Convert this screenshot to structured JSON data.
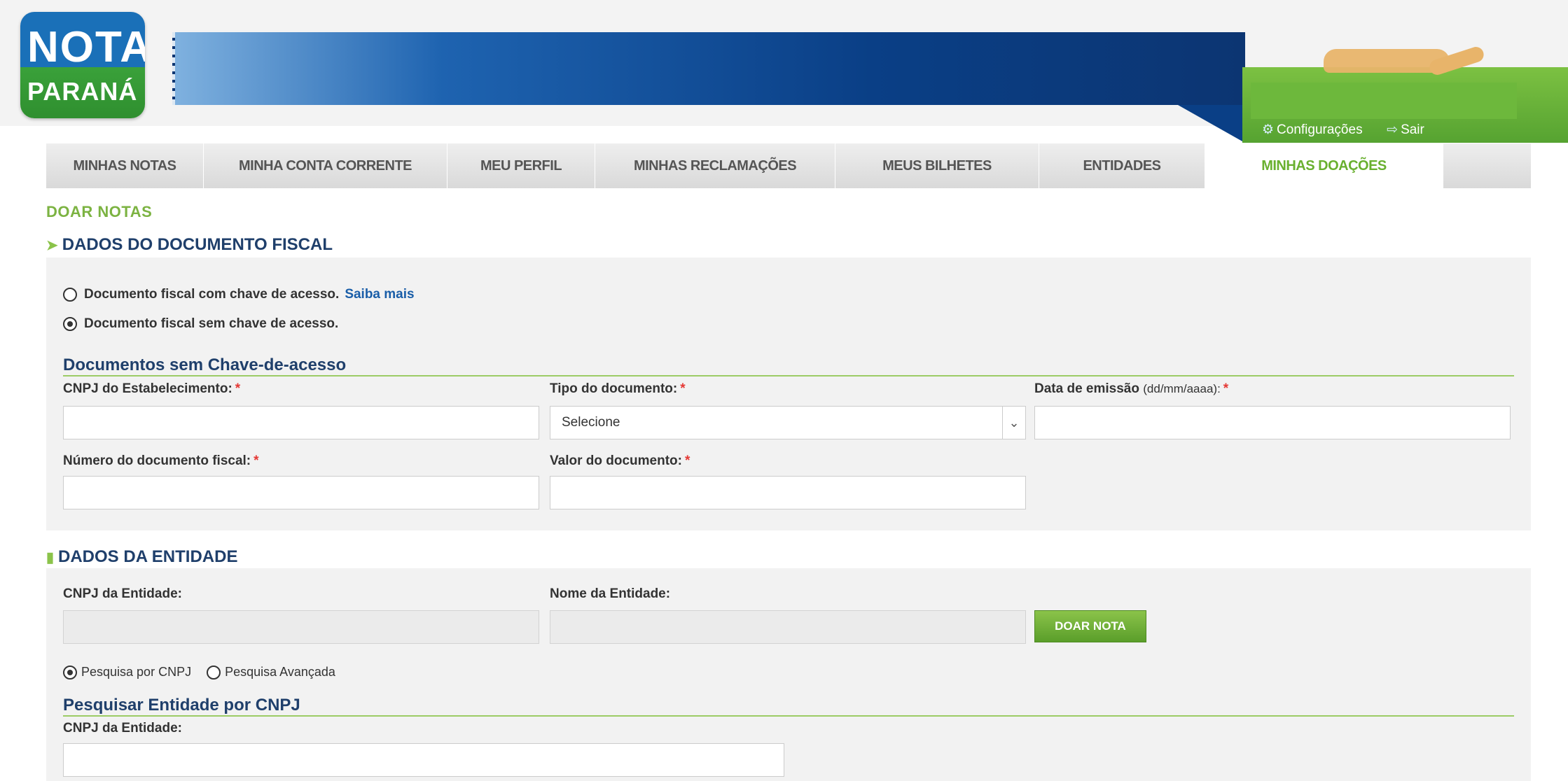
{
  "header": {
    "logo_top": "NOTA",
    "logo_bottom": "PARANÁ",
    "settings_label": "Configurações",
    "logout_label": "Sair",
    "settings_icon": "gear-icon",
    "logout_icon": "exit-icon"
  },
  "tabs": [
    {
      "label": "MINHAS NOTAS",
      "active": false
    },
    {
      "label": "MINHA CONTA CORRENTE",
      "active": false
    },
    {
      "label": "MEU PERFIL",
      "active": false
    },
    {
      "label": "MINHAS RECLAMAÇÕES",
      "active": false
    },
    {
      "label": "MEUS BILHETES",
      "active": false
    },
    {
      "label": "ENTIDADES",
      "active": false
    },
    {
      "label": "MINHAS DOAÇÕES",
      "active": true
    }
  ],
  "page": {
    "title": "DOAR NOTAS"
  },
  "fiscal": {
    "heading": "DADOS DO DOCUMENTO FISCAL",
    "heading_icon": "tag-icon",
    "option_with_key": "Documento fiscal com chave de acesso.",
    "saiba_mais": "Saiba mais",
    "option_without_key": "Documento fiscal sem chave de acesso.",
    "selected_option": "without_key",
    "subheading": "Documentos sem Chave-de-acesso",
    "cnpj_label": "CNPJ do Estabelecimento:",
    "tipo_label": "Tipo do documento:",
    "tipo_selected": "Selecione",
    "data_label": "Data de emissão",
    "data_hint": "(dd/mm/aaaa):",
    "numero_label": "Número do documento fiscal:",
    "valor_label": "Valor do documento:",
    "required_mark": "*"
  },
  "entity": {
    "heading": "DADOS DA ENTIDADE",
    "heading_icon": "building-icon",
    "cnpj_label": "CNPJ da Entidade:",
    "nome_label": "Nome da Entidade:",
    "donate_button": "DOAR NOTA",
    "search_cnpj": "Pesquisa por CNPJ",
    "search_advanced": "Pesquisa Avançada",
    "selected_search": "cnpj",
    "search_subheading": "Pesquisar Entidade por CNPJ",
    "search_cnpj_label": "CNPJ da Entidade:"
  },
  "colors": {
    "accent_green": "#69b02f",
    "navy": "#1f3f6b",
    "banner_blue": "#0a3f86",
    "required_red": "#e53935"
  }
}
